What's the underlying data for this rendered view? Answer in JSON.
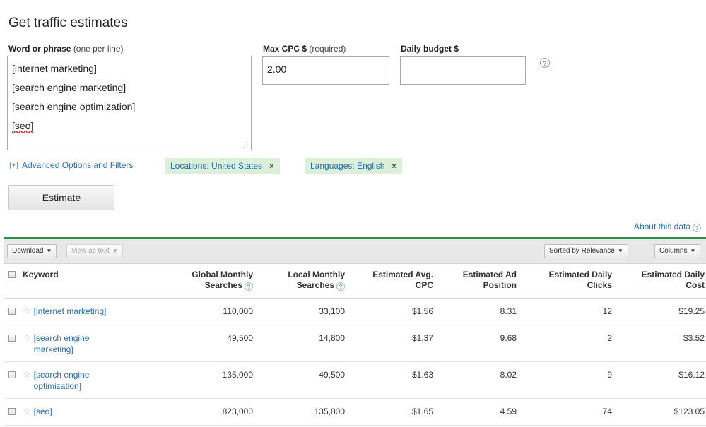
{
  "form": {
    "title": "Get traffic estimates",
    "word_label": "Word or phrase",
    "word_label_sub": "(one per line)",
    "keywords": [
      "[internet marketing]",
      "[search  engine marketing]",
      "[search engine optimization]",
      "[seo]"
    ],
    "max_cpc_label": "Max CPC $",
    "max_cpc_label_sub": "(required)",
    "max_cpc_value": "2.00",
    "daily_budget_label": "Daily budget $",
    "daily_budget_value": "",
    "help_glyph": "?",
    "advanced_label": "Advanced Options and Filters",
    "location_chip": "Locations: United States",
    "language_chip": "Languages: English",
    "chip_remove": "×",
    "estimate_label": "Estimate"
  },
  "about": "About this data",
  "toolbar": {
    "download": "Download",
    "view_as_text": "View as text",
    "sorted_by": "Sorted by Relevance",
    "columns": "Columns",
    "caret": "▼"
  },
  "table": {
    "headers": {
      "keyword": "Keyword",
      "global_1": "Global Monthly",
      "global_2": "Searches",
      "local_1": "Local Monthly",
      "local_2": "Searches",
      "cpc_1": "Estimated Avg.",
      "cpc_2": "CPC",
      "pos_1": "Estimated Ad",
      "pos_2": "Position",
      "clicks_1": "Estimated Daily",
      "clicks_2": "Clicks",
      "cost_1": "Estimated Daily",
      "cost_2": "Cost"
    },
    "rows": [
      {
        "kw1": "[internet marketing]",
        "kw2": "",
        "global": "110,000",
        "local": "33,100",
        "cpc": "$1.56",
        "pos": "8.31",
        "clicks": "12",
        "cost": "$19.25"
      },
      {
        "kw1": "[search engine",
        "kw2": "marketing]",
        "global": "49,500",
        "local": "14,800",
        "cpc": "$1.37",
        "pos": "9.68",
        "clicks": "2",
        "cost": "$3.52"
      },
      {
        "kw1": "[search engine",
        "kw2": "optimization]",
        "global": "135,000",
        "local": "49,500",
        "cpc": "$1.63",
        "pos": "8.02",
        "clicks": "9",
        "cost": "$16.12"
      },
      {
        "kw1": "[seo]",
        "kw2": "",
        "global": "823,000",
        "local": "135,000",
        "cpc": "$1.65",
        "pos": "4.59",
        "clicks": "74",
        "cost": "$123.05"
      }
    ]
  }
}
